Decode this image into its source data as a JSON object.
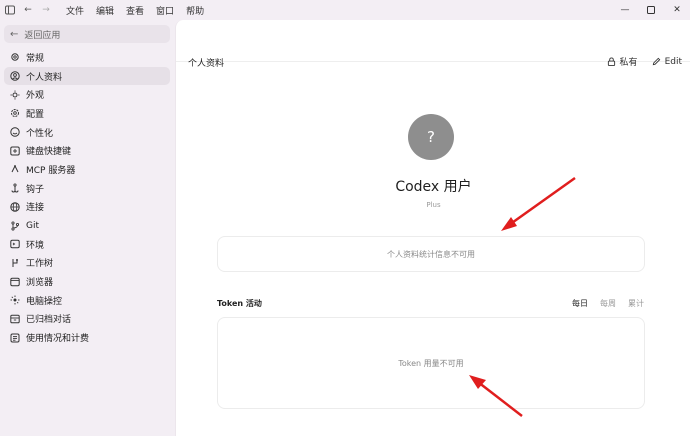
{
  "titlebar": {
    "menu": [
      "文件",
      "编辑",
      "查看",
      "窗口",
      "帮助"
    ]
  },
  "sidebar": {
    "back_label": "返回应用",
    "items": [
      {
        "label": "常规",
        "icon": "gear-icon"
      },
      {
        "label": "个人资料",
        "icon": "user-icon",
        "active": true
      },
      {
        "label": "外观",
        "icon": "sun-icon"
      },
      {
        "label": "配置",
        "icon": "settings-icon"
      },
      {
        "label": "个性化",
        "icon": "smile-icon"
      },
      {
        "label": "键盘快捷键",
        "icon": "keyboard-icon"
      },
      {
        "label": "MCP 服务器",
        "icon": "server-icon"
      },
      {
        "label": "钩子",
        "icon": "hook-icon"
      },
      {
        "label": "连接",
        "icon": "globe-icon"
      },
      {
        "label": "Git",
        "icon": "git-icon"
      },
      {
        "label": "环境",
        "icon": "environment-icon"
      },
      {
        "label": "工作树",
        "icon": "tree-icon"
      },
      {
        "label": "浏览器",
        "icon": "browser-icon"
      },
      {
        "label": "电脑操控",
        "icon": "control-icon"
      },
      {
        "label": "已归档对话",
        "icon": "archive-icon"
      },
      {
        "label": "使用情况和计费",
        "icon": "billing-icon"
      }
    ]
  },
  "main": {
    "title": "个人资料",
    "private_label": "私有",
    "edit_label": "Edit",
    "avatar_glyph": "?",
    "user_name": "Codex 用户",
    "plan": "Plus",
    "stats_unavailable": "个人资料统计信息不可用",
    "token_title": "Token 活动",
    "token_tabs": [
      "每日",
      "每周",
      "累计"
    ],
    "token_unavailable": "Token 用量不可用"
  },
  "colors": {
    "sidebar_bg": "#f3eef4",
    "active_item_bg": "#e6e0e7",
    "annotation_arrow": "#e01e1e"
  }
}
